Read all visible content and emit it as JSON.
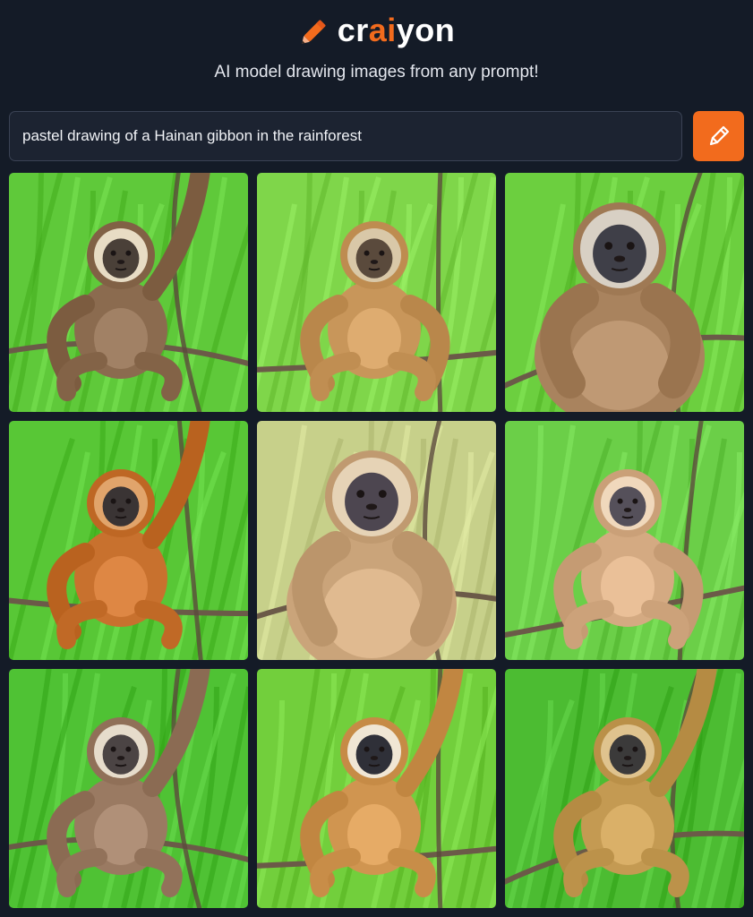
{
  "header": {
    "logo_prefix": "cr",
    "logo_accent": "ai",
    "logo_suffix": "yon",
    "tagline": "AI model drawing images from any prompt!"
  },
  "search": {
    "prompt_value": "pastel drawing of a Hainan gibbon in the rainforest",
    "draw_button_icon": "pencil-icon"
  },
  "colors": {
    "background": "#141b27",
    "accent": "#f26b1d",
    "input_bg": "#1c2331"
  },
  "results": {
    "images": [
      {
        "subject": "gibbon",
        "bg": "#5fc93a",
        "fur": "#8b6b4f",
        "face": "#e8dcc4",
        "mask": "#4a4038",
        "pose": "hanging"
      },
      {
        "subject": "gibbon",
        "bg": "#7fd64a",
        "fur": "#c8965a",
        "face": "#d9c8a8",
        "mask": "#5a4a3c",
        "pose": "sitting-branch"
      },
      {
        "subject": "gibbon",
        "bg": "#6ccf3f",
        "fur": "#a9835e",
        "face": "#d8d0c4",
        "mask": "#3f3f48",
        "pose": "closeup"
      },
      {
        "subject": "gibbon",
        "bg": "#58c736",
        "fur": "#c8712e",
        "face": "#e1a46b",
        "mask": "#3a3434",
        "pose": "swinging"
      },
      {
        "subject": "gibbon",
        "bg": "#c7d08a",
        "fur": "#caa47a",
        "face": "#e6d3b6",
        "mask": "#4d4650",
        "pose": "closeup"
      },
      {
        "subject": "gibbon",
        "bg": "#6bcf48",
        "fur": "#d4aa82",
        "face": "#f0d8bc",
        "mask": "#55505a",
        "pose": "holding-vine"
      },
      {
        "subject": "gibbon",
        "bg": "#4fc234",
        "fur": "#9a7a62",
        "face": "#e6dccb",
        "mask": "#4b4444",
        "pose": "reaching"
      },
      {
        "subject": "gibbon",
        "bg": "#72cf3c",
        "fur": "#d09550",
        "face": "#f0e6d4",
        "mask": "#2f3038",
        "pose": "arm-up"
      },
      {
        "subject": "gibbon",
        "bg": "#4cbc32",
        "fur": "#c49a52",
        "face": "#dfc38e",
        "mask": "#3b3a3a",
        "pose": "hanging"
      }
    ]
  }
}
